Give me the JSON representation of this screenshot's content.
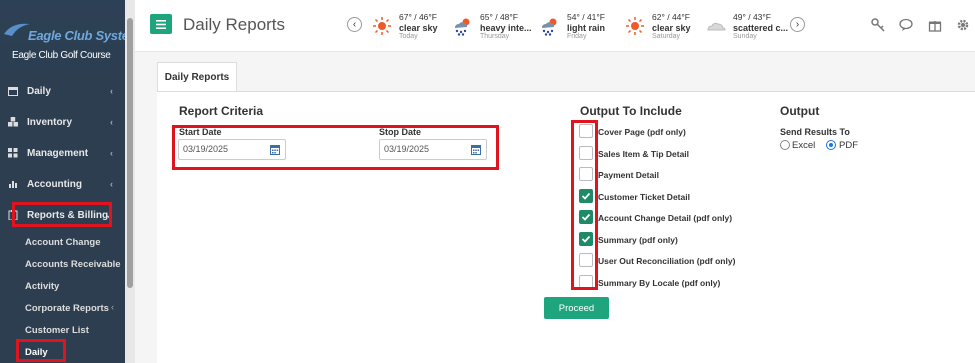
{
  "logo": {
    "title": "Eagle Club Systems",
    "subtitle": "Eagle Club Golf Course"
  },
  "sidebar": {
    "items": [
      {
        "label": "Daily",
        "icon": "calendar-icon"
      },
      {
        "label": "Inventory",
        "icon": "cubes-icon"
      },
      {
        "label": "Management",
        "icon": "grid-icon"
      },
      {
        "label": "Accounting",
        "icon": "bar-chart-icon"
      },
      {
        "label": "Reports & Billing",
        "icon": "clipboard-icon"
      }
    ],
    "sub_items": [
      "Account Change",
      "Accounts Receivable",
      "Activity",
      "Corporate Reports",
      "Customer List",
      "Daily"
    ]
  },
  "header": {
    "title": "Daily Reports"
  },
  "weather": [
    {
      "temp": "67° / 46°F",
      "condition": "clear sky",
      "day": "Today",
      "icon": "sun-icon"
    },
    {
      "temp": "65° / 48°F",
      "condition": "heavy inte...",
      "day": "Thursday",
      "icon": "rain-sun-icon"
    },
    {
      "temp": "54° / 41°F",
      "condition": "light rain",
      "day": "Friday",
      "icon": "rain-sun-icon"
    },
    {
      "temp": "62° / 44°F",
      "condition": "clear sky",
      "day": "Saturday",
      "icon": "sun-icon"
    },
    {
      "temp": "49° / 43°F",
      "condition": "scattered c...",
      "day": "Sunday",
      "icon": "cloud-icon"
    }
  ],
  "tab": {
    "label": "Daily Reports"
  },
  "criteria": {
    "title": "Report Criteria",
    "start_label": "Start Date",
    "start_value": "03/19/2025",
    "stop_label": "Stop Date",
    "stop_value": "03/19/2025"
  },
  "output_include": {
    "title": "Output To Include",
    "options": [
      {
        "label": "Cover Page (pdf only)",
        "checked": false
      },
      {
        "label": "Sales Item & Tip Detail",
        "checked": false
      },
      {
        "label": "Payment Detail",
        "checked": false
      },
      {
        "label": "Customer Ticket Detail",
        "checked": true
      },
      {
        "label": "Account Change Detail (pdf only)",
        "checked": true
      },
      {
        "label": "Summary (pdf only)",
        "checked": true
      },
      {
        "label": "User Out Reconciliation (pdf only)",
        "checked": false
      },
      {
        "label": "Summary By Locale (pdf only)",
        "checked": false
      }
    ]
  },
  "output": {
    "title": "Output",
    "send_label": "Send Results To",
    "excel_label": "Excel",
    "pdf_label": "PDF",
    "selected": "PDF"
  },
  "proceed_label": "Proceed",
  "colors": {
    "accent": "#1fa57d",
    "sidebar": "#2c3e50",
    "highlight": "#e0141e"
  }
}
